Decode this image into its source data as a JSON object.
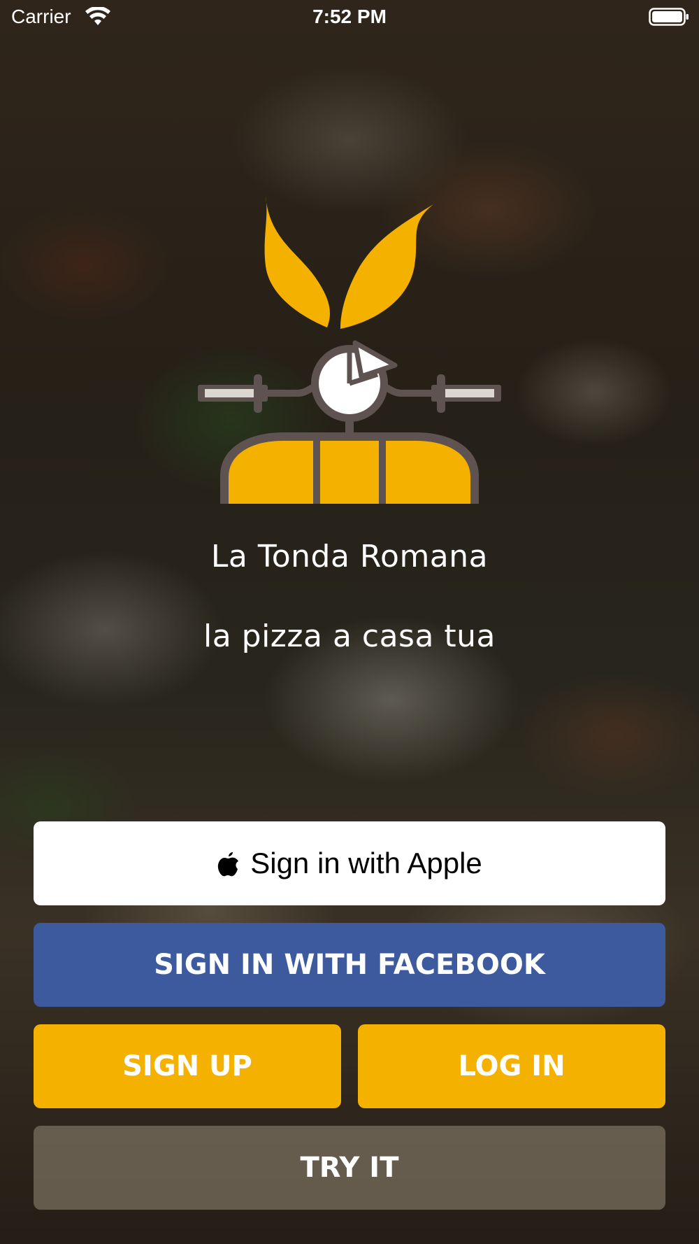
{
  "status_bar": {
    "carrier": "Carrier",
    "time": "7:52 PM",
    "icons": [
      "wifi-icon",
      "battery-icon"
    ]
  },
  "brand": {
    "title": "La Tonda Romana",
    "subtitle": "la pizza a casa tua",
    "logo": "scooter-pizza-logo",
    "colors": {
      "logo_yellow": "#f5b100",
      "logo_outline": "#5e5350"
    }
  },
  "buttons": {
    "apple": "Sign in with Apple",
    "facebook": "SIGN IN WITH FACEBOOK",
    "signup": "SIGN UP",
    "login": "LOG IN",
    "try_it": "TRY IT"
  },
  "colors": {
    "facebook_blue": "#3d5a9e",
    "accent_yellow": "#f5b100",
    "apple_button": "#ffffff"
  }
}
